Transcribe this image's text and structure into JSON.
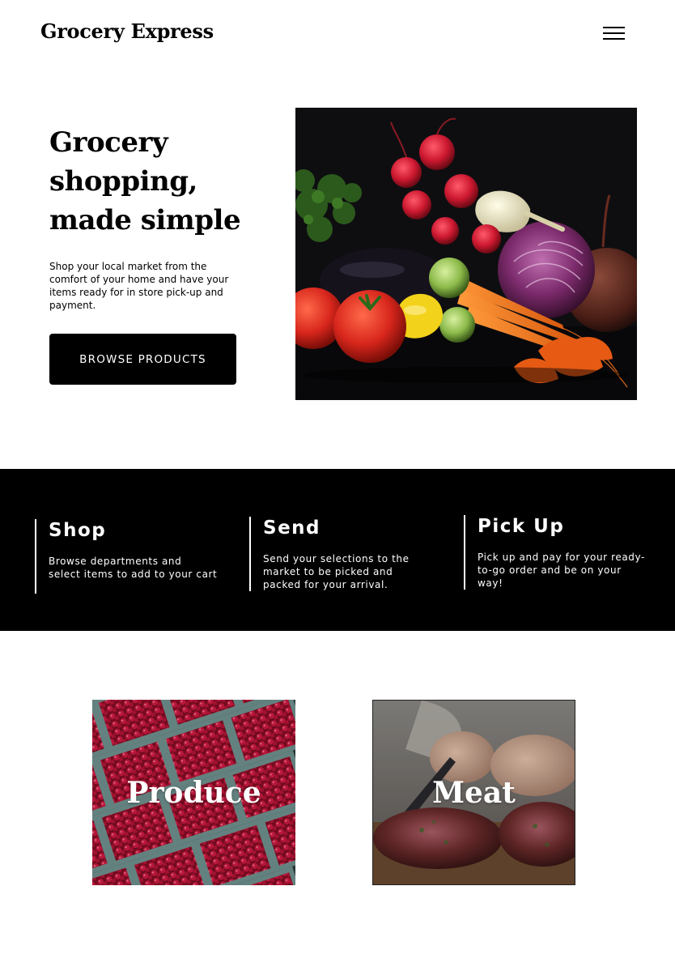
{
  "header": {
    "brand": "Grocery Express",
    "menu_icon": "hamburger-menu-icon"
  },
  "hero": {
    "title_lines": [
      "Grocery",
      "shopping,",
      "made simple"
    ],
    "description_lines": [
      "Shop your local market from the",
      "comfort of your home and have your",
      "items ready for in store pick-up and",
      "payment."
    ],
    "cta_label": "BROWSE PRODUCTS",
    "image": "vegetables-still-life-image"
  },
  "steps": [
    {
      "title": "Shop",
      "lines": [
        "Browse departments and",
        "select items to add to your cart"
      ]
    },
    {
      "title": "Send",
      "lines": [
        "Send your selections to the",
        "market to be picked and",
        "packed for your arrival."
      ]
    },
    {
      "title": "Pick Up",
      "lines": [
        "Pick up and pay for your ready-",
        "to-go order and be on your",
        "way!"
      ]
    }
  ],
  "categories": [
    {
      "label": "Produce",
      "image": "raspberries-image"
    },
    {
      "label": "Meat",
      "image": "meat-butcher-image"
    }
  ],
  "colors": {
    "primary": "#000000",
    "background": "#ffffff",
    "text_on_dark": "#ffffff"
  }
}
